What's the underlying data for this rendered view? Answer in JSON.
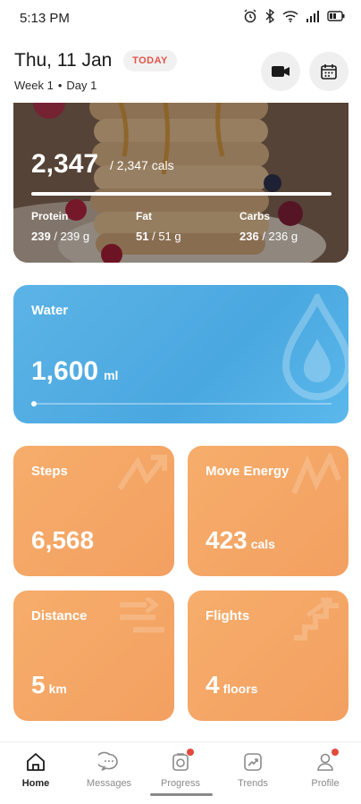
{
  "status_bar": {
    "time": "5:13 PM"
  },
  "header": {
    "date": "Thu, 11 Jan",
    "today_badge": "TODAY",
    "week": "Week 1",
    "day": "Day 1"
  },
  "nutrition": {
    "calories": "2,347",
    "calories_target": "/ 2,347 cals",
    "progress": 1.0,
    "macros": [
      {
        "label": "Protein",
        "value": "239",
        "target": "/ 239 g"
      },
      {
        "label": "Fat",
        "value": "51",
        "target": "/ 51 g"
      },
      {
        "label": "Carbs",
        "value": "236",
        "target": "/ 236 g"
      }
    ]
  },
  "water": {
    "title": "Water",
    "value": "1,600",
    "unit": "ml",
    "progress": 0.0
  },
  "stats": [
    {
      "title": "Steps",
      "value": "6,568",
      "unit": ""
    },
    {
      "title": "Move Energy",
      "value": "423",
      "unit": "cals"
    },
    {
      "title": "Distance",
      "value": "5",
      "unit": "km"
    },
    {
      "title": "Flights",
      "value": "4",
      "unit": "floors"
    }
  ],
  "nav": [
    {
      "label": "Home",
      "icon": "home-icon",
      "active": true,
      "badge": false
    },
    {
      "label": "Messages",
      "icon": "chat-icon",
      "active": false,
      "badge": false
    },
    {
      "label": "Progress",
      "icon": "progress-icon",
      "active": false,
      "badge": true
    },
    {
      "label": "Trends",
      "icon": "trends-icon",
      "active": false,
      "badge": false
    },
    {
      "label": "Profile",
      "icon": "profile-icon",
      "active": false,
      "badge": true
    }
  ],
  "colors": {
    "water_card": "#4aa8e0",
    "stat_card": "#f3a061",
    "badge_red": "#e24a3d",
    "today_text": "#e2544a"
  }
}
